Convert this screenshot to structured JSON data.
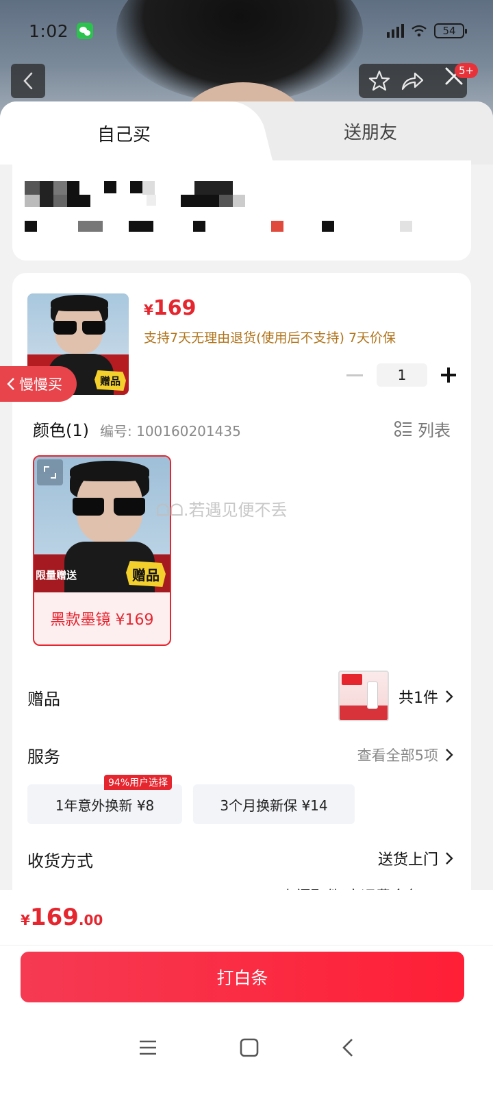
{
  "status_bar": {
    "time": "1:02",
    "battery": "54"
  },
  "tabs": {
    "self_buy": "自己买",
    "send_friend": "送朋友"
  },
  "product": {
    "currency": "¥",
    "price": "169",
    "policy": "支持7天无理由退货(使用后不支持) 7天价保",
    "quantity": "1",
    "gift_badge": "赠品"
  },
  "slow_buy": {
    "label": "慢慢买"
  },
  "color": {
    "title": "颜色(1)",
    "code": "编号: 100160201435",
    "list_toggle": "列表",
    "variants": [
      {
        "label": "黑款墨镜 ¥169",
        "tag": "限量赠送",
        "gift_badge": "赠品"
      }
    ]
  },
  "watermark": "ᗝᗝ.若遇见便不丢",
  "gift_row": {
    "label": "赠品",
    "count": "共1件"
  },
  "service_row": {
    "label": "服务",
    "view_all": "查看全部5项",
    "options": [
      {
        "label": "1年意外换新 ¥8",
        "tag": "94%用户选择"
      },
      {
        "label": "3个月换新保 ¥14"
      }
    ]
  },
  "delivery_row": {
    "label": "收货方式",
    "value": "送货上门",
    "note_cutoff": "上门取件 寄运费全免"
  },
  "footer": {
    "currency": "¥",
    "total_int": "169",
    "total_dec": ".00",
    "pay_button": "打白条"
  },
  "colors": {
    "accent": "#e5262f",
    "policy": "#b0741b"
  }
}
